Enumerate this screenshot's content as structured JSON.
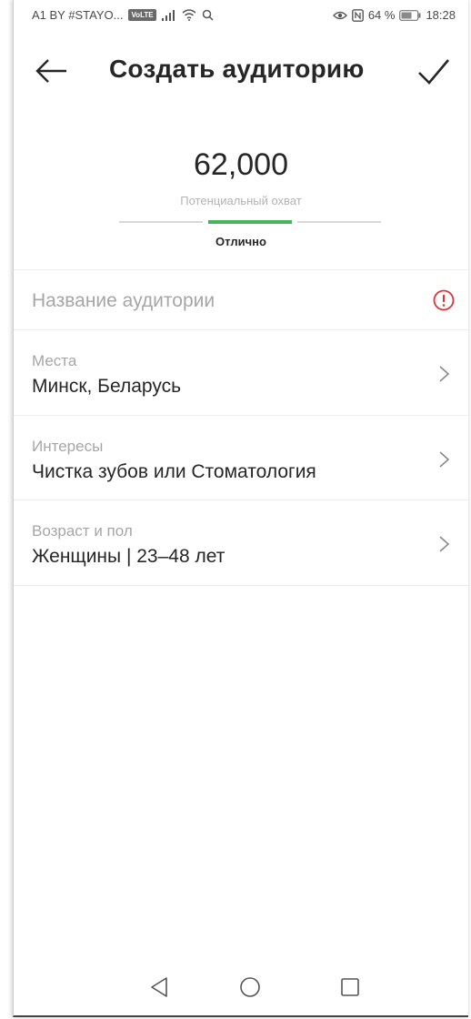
{
  "status_bar": {
    "carrier": "A1 BY #STAYO...",
    "badge": "VoLTE",
    "battery_percent": "64 %",
    "time": "18:28",
    "icons": [
      "signal-icon",
      "wifi-icon",
      "search-icon",
      "eye-icon",
      "nfc-icon",
      "battery-icon"
    ]
  },
  "header": {
    "title": "Создать аудиторию",
    "back_icon": "arrow-left-icon",
    "confirm_icon": "checkmark-icon"
  },
  "reach": {
    "value": "62,000",
    "label": "Потенциальный охват",
    "rating": "Отлично",
    "meter_segments": 3,
    "meter_active_segment": 2,
    "accent_color": "#46b45a"
  },
  "form": {
    "name_field": {
      "placeholder": "Название аудитории",
      "status_icon": "alert-circle-icon",
      "status_color": "#e0333a"
    },
    "rows": [
      {
        "label": "Места",
        "value": "Минск, Беларусь"
      },
      {
        "label": "Интересы",
        "value": "Чистка зубов или Стоматология"
      },
      {
        "label": "Возраст и пол",
        "value": "Женщины | 23–48 лет"
      }
    ]
  },
  "nav_bar": {
    "icons": [
      "back-triangle-icon",
      "home-circle-icon",
      "recents-square-icon"
    ]
  }
}
